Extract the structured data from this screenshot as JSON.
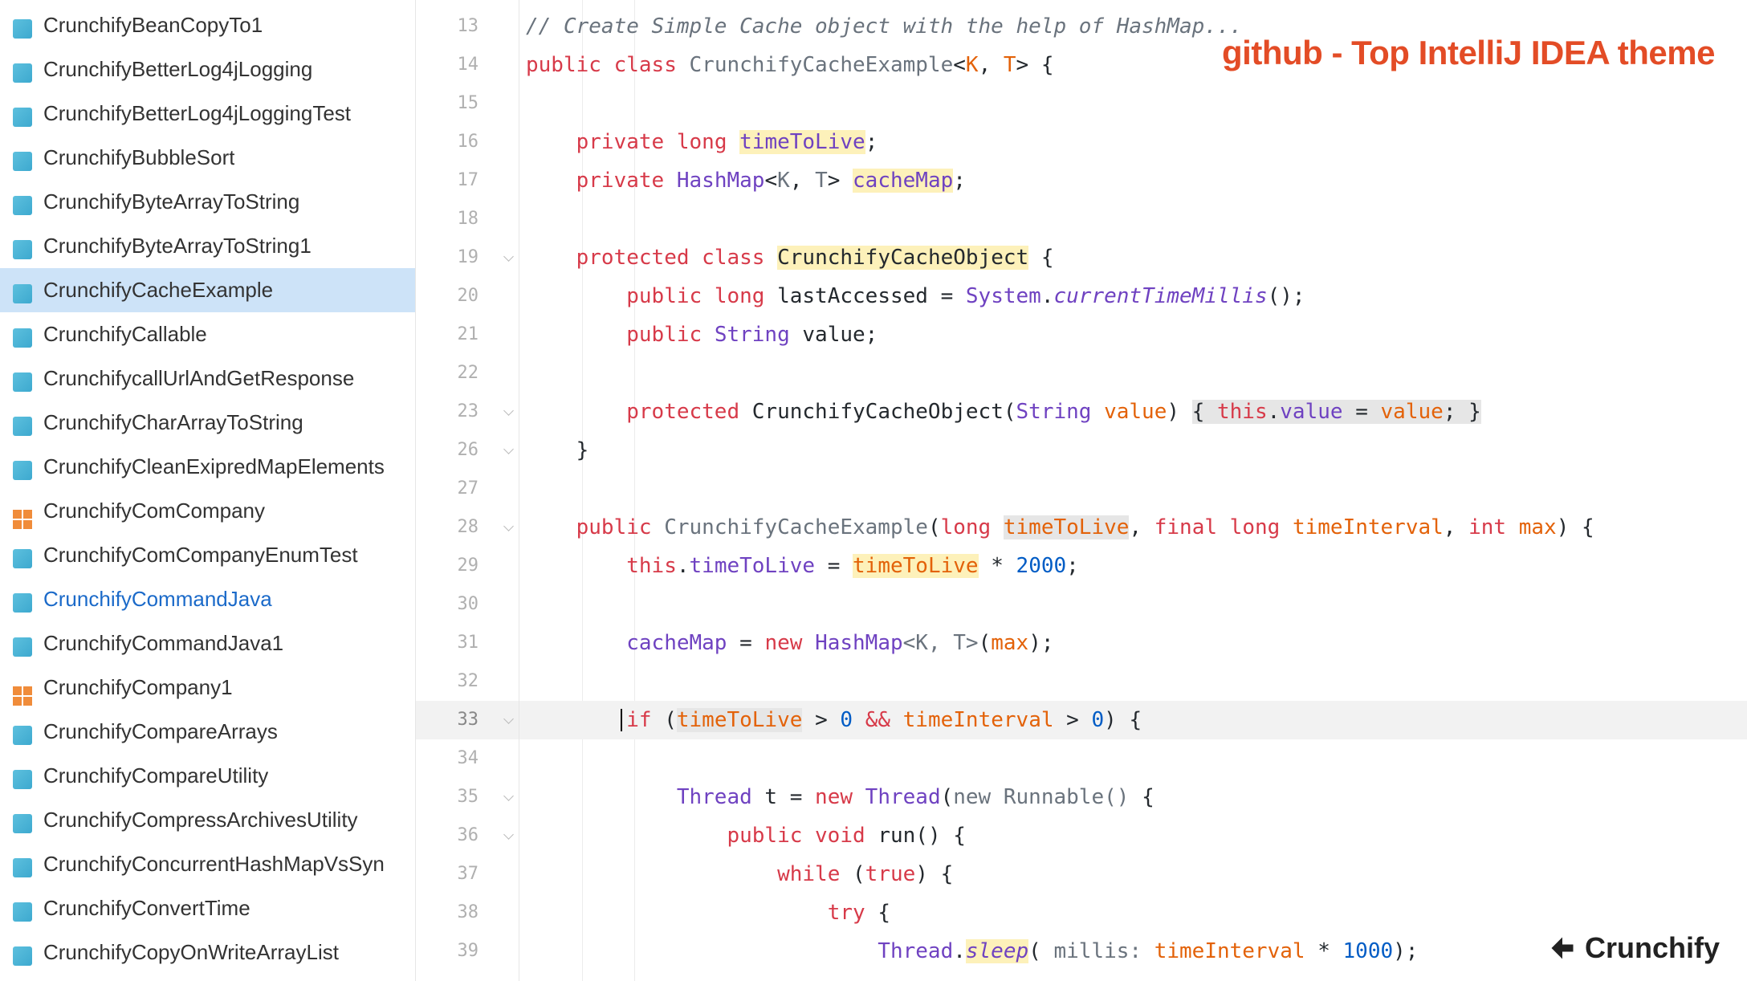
{
  "hero_label": "github - Top IntelliJ IDEA theme",
  "brand_label": "Crunchify",
  "tree": {
    "items": [
      {
        "label": "CrunchifyBeanCopyTo1",
        "icon": "class"
      },
      {
        "label": "CrunchifyBetterLog4jLogging",
        "icon": "class"
      },
      {
        "label": "CrunchifyBetterLog4jLoggingTest",
        "icon": "class"
      },
      {
        "label": "CrunchifyBubbleSort",
        "icon": "class"
      },
      {
        "label": "CrunchifyByteArrayToString",
        "icon": "class"
      },
      {
        "label": "CrunchifyByteArrayToString1",
        "icon": "class"
      },
      {
        "label": "CrunchifyCacheExample",
        "icon": "class",
        "selected": true
      },
      {
        "label": "CrunchifyCallable",
        "icon": "class"
      },
      {
        "label": "CrunchifycallUrlAndGetResponse",
        "icon": "class"
      },
      {
        "label": "CrunchifyCharArrayToString",
        "icon": "class"
      },
      {
        "label": "CrunchifyCleanExipredMapElements",
        "icon": "class"
      },
      {
        "label": "CrunchifyComCompany",
        "icon": "pkg"
      },
      {
        "label": "CrunchifyComCompanyEnumTest",
        "icon": "class"
      },
      {
        "label": "CrunchifyCommandJava",
        "icon": "class",
        "blue": true
      },
      {
        "label": "CrunchifyCommandJava1",
        "icon": "class"
      },
      {
        "label": "CrunchifyCompany1",
        "icon": "pkg"
      },
      {
        "label": "CrunchifyCompareArrays",
        "icon": "class"
      },
      {
        "label": "CrunchifyCompareUtility",
        "icon": "class"
      },
      {
        "label": "CrunchifyCompressArchivesUtility",
        "icon": "class"
      },
      {
        "label": "CrunchifyConcurrentHashMapVsSyn",
        "icon": "class"
      },
      {
        "label": "CrunchifyConvertTime",
        "icon": "class"
      },
      {
        "label": "CrunchifyCopyOnWriteArrayList",
        "icon": "class"
      }
    ]
  },
  "gutter": {
    "line_numbers": [
      "13",
      "14",
      "15",
      "16",
      "17",
      "18",
      "19",
      "20",
      "21",
      "22",
      "23",
      "26",
      "27",
      "28",
      "29",
      "30",
      "31",
      "32",
      "33",
      "34",
      "35",
      "36",
      "37",
      "38",
      "39"
    ],
    "current_index": 18,
    "fold_at": [
      6,
      10,
      11,
      13,
      18,
      20,
      21
    ]
  },
  "code": {
    "l13_comment": "// Create Simple Cache object with the help of HashMap...",
    "kw_public": "public",
    "kw_class": "class",
    "kw_private": "private",
    "kw_protected": "protected",
    "kw_long": "long",
    "kw_final": "final",
    "kw_int": "int",
    "kw_new": "new",
    "kw_if": "if",
    "kw_void": "void",
    "kw_while": "while",
    "kw_true": "true",
    "kw_try": "try",
    "kw_this": "this",
    "t_main": "CrunchifyCacheExample",
    "t_obj": "CrunchifyCacheObject",
    "t_hashmap": "HashMap",
    "t_string": "String",
    "t_thread": "Thread",
    "t_runnable": "Runnable",
    "t_system": "System",
    "g_open": "<",
    "g_close": ">",
    "g_k": "K",
    "g_t": "T",
    "g_sep": ", ",
    "f_ttl": "timeToLive",
    "f_cache": "cacheMap",
    "f_last": "lastAccessed",
    "f_value": "value",
    "m_ctm": "currentTimeMillis",
    "m_sleep": "sleep",
    "m_run": "run",
    "p_ttl": "timeToLive",
    "p_ti": "timeInterval",
    "p_max": "max",
    "p_value": "value",
    "p_millis": "millis:",
    "v_t": "t",
    "n_2000": "2000",
    "n_0": "0",
    "n_1000": "1000",
    "s_brace_o": "{",
    "s_brace_c": "}",
    "s_paren_o": "(",
    "s_paren_c": ")",
    "s_semi": ";",
    "s_dot": ".",
    "s_comma": ",",
    "s_eq": "=",
    "s_star": "*",
    "s_gt": ">",
    "s_and": "&&"
  }
}
